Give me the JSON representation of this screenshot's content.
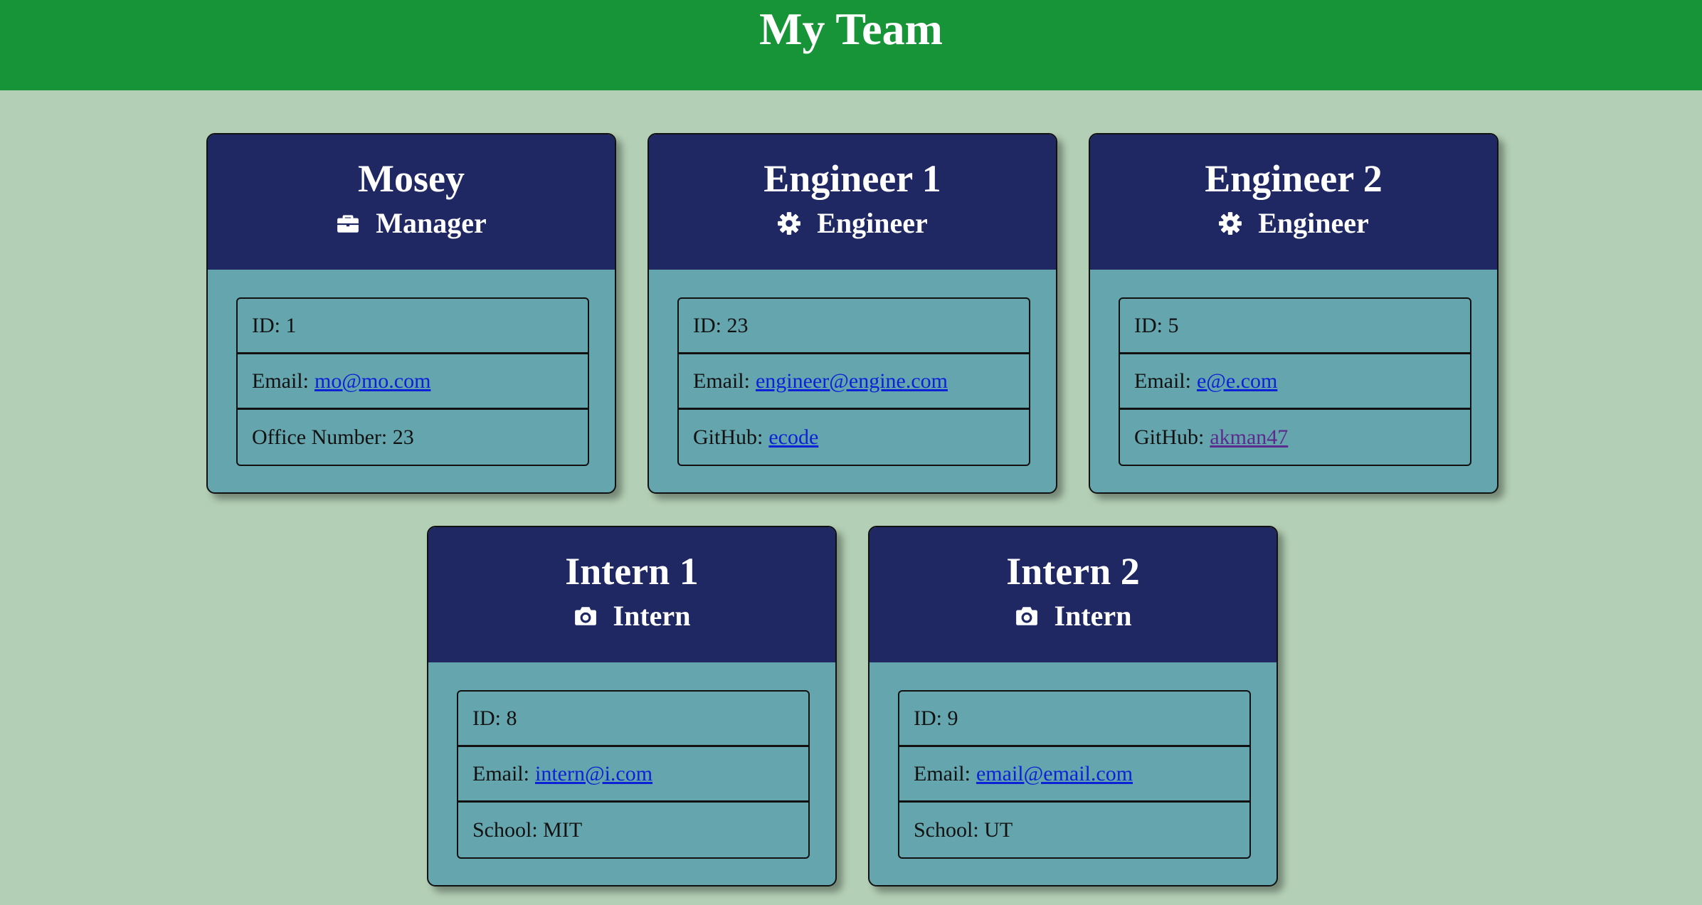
{
  "header": {
    "title": "My Team"
  },
  "cards": [
    {
      "name": "Mosey",
      "role": "Manager",
      "icon": "briefcase-icon",
      "id_text": "ID: 1",
      "email_label": "Email:",
      "email": "mo@mo.com",
      "extra_label": "Office Number: 23",
      "extra_link": ""
    },
    {
      "name": "Engineer 1",
      "role": "Engineer",
      "icon": "gear-icon",
      "id_text": "ID: 23",
      "email_label": "Email:",
      "email": "engineer@engine.com",
      "extra_label": "GitHub:",
      "extra_link": "ecode"
    },
    {
      "name": "Engineer 2",
      "role": "Engineer",
      "icon": "gear-icon",
      "id_text": "ID: 5",
      "email_label": "Email:",
      "email": "e@e.com",
      "extra_label": "GitHub:",
      "extra_link": "akman47"
    },
    {
      "name": "Intern 1",
      "role": "Intern",
      "icon": "camera-icon",
      "id_text": "ID: 8",
      "email_label": "Email:",
      "email": "intern@i.com",
      "extra_label": "School: MIT",
      "extra_link": ""
    },
    {
      "name": "Intern 2",
      "role": "Intern",
      "icon": "camera-icon",
      "id_text": "ID: 9",
      "email_label": "Email:",
      "email": "email@email.com",
      "extra_label": "School: UT",
      "extra_link": ""
    }
  ],
  "colors": {
    "header": "#179438",
    "background": "#b3cfb5",
    "card_head": "#202863",
    "card_body": "#65a6ae",
    "link": "#0b22d6",
    "visited_link": "#5b2b8e"
  }
}
